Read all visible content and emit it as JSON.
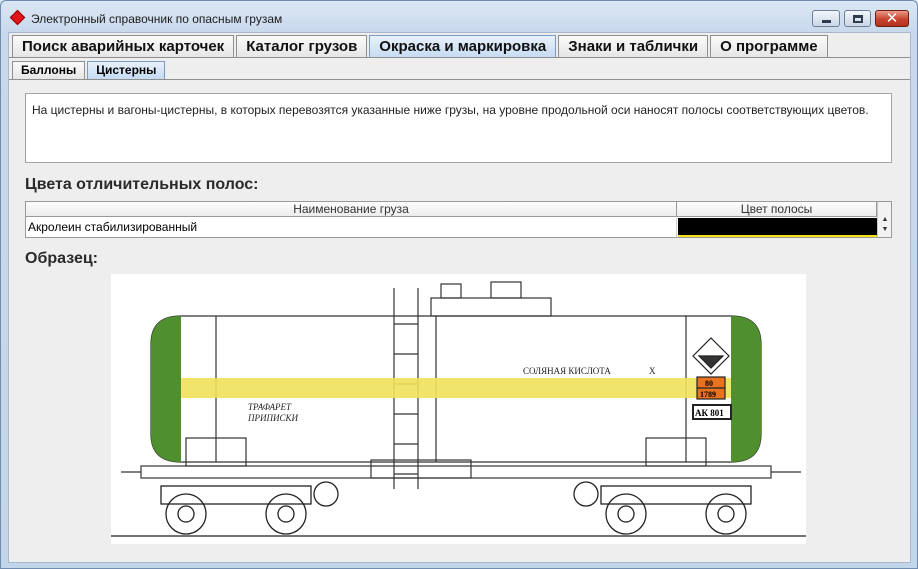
{
  "window": {
    "title": "Электронный справочник по опасным грузам"
  },
  "tabs": [
    {
      "label": "Поиск аварийных карточек"
    },
    {
      "label": "Каталог грузов"
    },
    {
      "label": "Окраска и маркировка"
    },
    {
      "label": "Знаки и таблички"
    },
    {
      "label": "О программе"
    }
  ],
  "subtabs": [
    {
      "label": "Баллоны"
    },
    {
      "label": "Цистерны"
    }
  ],
  "description": "На цистерны и вагоны-цистерны, в которых перевозятся указанные ниже грузы, на уровне продольной оси наносят полосы соответствующих цветов.",
  "stripes_section": {
    "heading": "Цвета отличительных полос:",
    "columns": {
      "name": "Наименование груза",
      "color": "Цвет полосы"
    },
    "rows": [
      {
        "name": "Акролеин стабилизированный",
        "color": "#000000"
      }
    ]
  },
  "sample": {
    "heading": "Образец:",
    "tank_text_1": "СОЛЯНАЯ  КИСЛОТА",
    "tank_text_x": "Х",
    "stencil_line_1": "ТРАФАРЕТ",
    "stencil_line_2": "ПРИПИСКИ",
    "plate_top": "80",
    "plate_bottom": "1789",
    "wagon_number": "АК 801",
    "end_color": "#4f8f2e",
    "stripe_color": "#efe15a"
  },
  "accent_colors": {
    "active_tab": "#c5daf2",
    "close_button": "#c7432d"
  }
}
